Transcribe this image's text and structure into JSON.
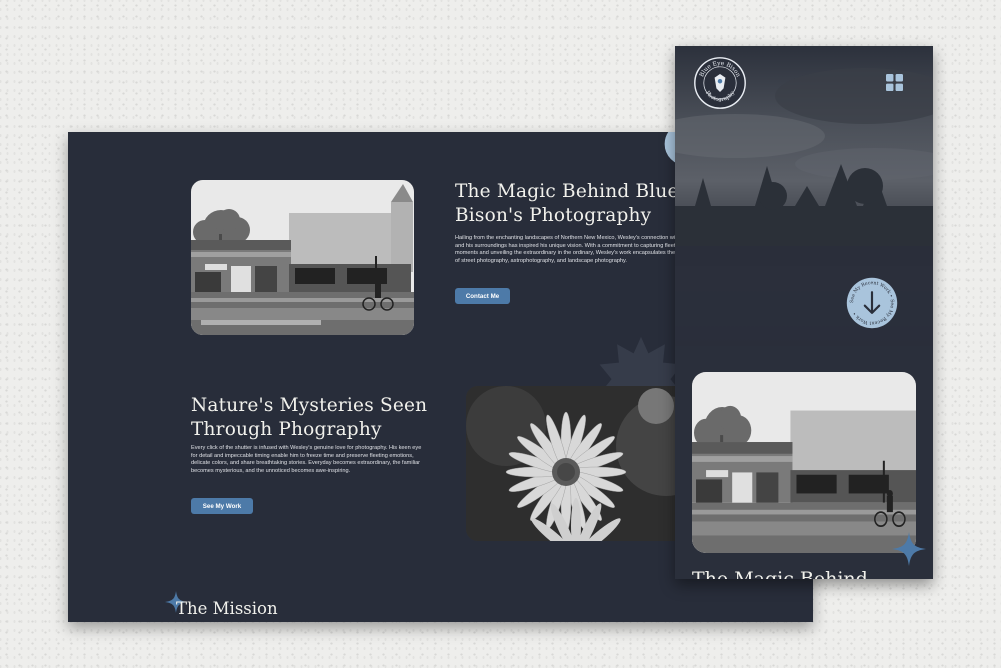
{
  "desktop": {
    "section1": {
      "heading": "The Magic Behind Blue Eye Bison's Photography",
      "paragraph": "Hailing from the enchanting landscapes of Northern New Mexico, Wesley's connection with nature and his surroundings has inspired his unique vision. With a commitment to capturing fleeting moments and unveiling the extraordinary in the ordinary, Wesley's work encapsulates the essence of street photography, astrophotography, and landscape photography.",
      "button": "Contact Me"
    },
    "section2": {
      "heading": "Nature's Mysteries Seen Through Phography",
      "paragraph": "Every click of the shutter is infused with Wesley's genuine love for photography. His keen eye for detail and impeccable timing enable him to freeze time and preserve fleeting emotions, delicate colors, and share breathtaking stories. Everyday becomes extraordinary, the familiar becomes mysterious, and the unnoticed becomes awe-inspiring.",
      "button": "See My Work"
    },
    "section3": {
      "heading": "The Mission"
    }
  },
  "mobile": {
    "logo_text_top": "Blue Eye Bison",
    "logo_text_bottom": "Photography",
    "scroll_badge_text": "See My Recent Work • See My Recent Work •",
    "peek_heading": "The Magic Behind"
  },
  "colors": {
    "panel": "#282d3a",
    "accent": "#4d7aa8",
    "heading": "#f1f1ec",
    "badge": "#a9c4dc"
  },
  "icons": {
    "menu": "grid-icon",
    "scroll": "arrow-down-icon",
    "sparkle": "sparkle-icon",
    "cog": "badge-shape"
  }
}
